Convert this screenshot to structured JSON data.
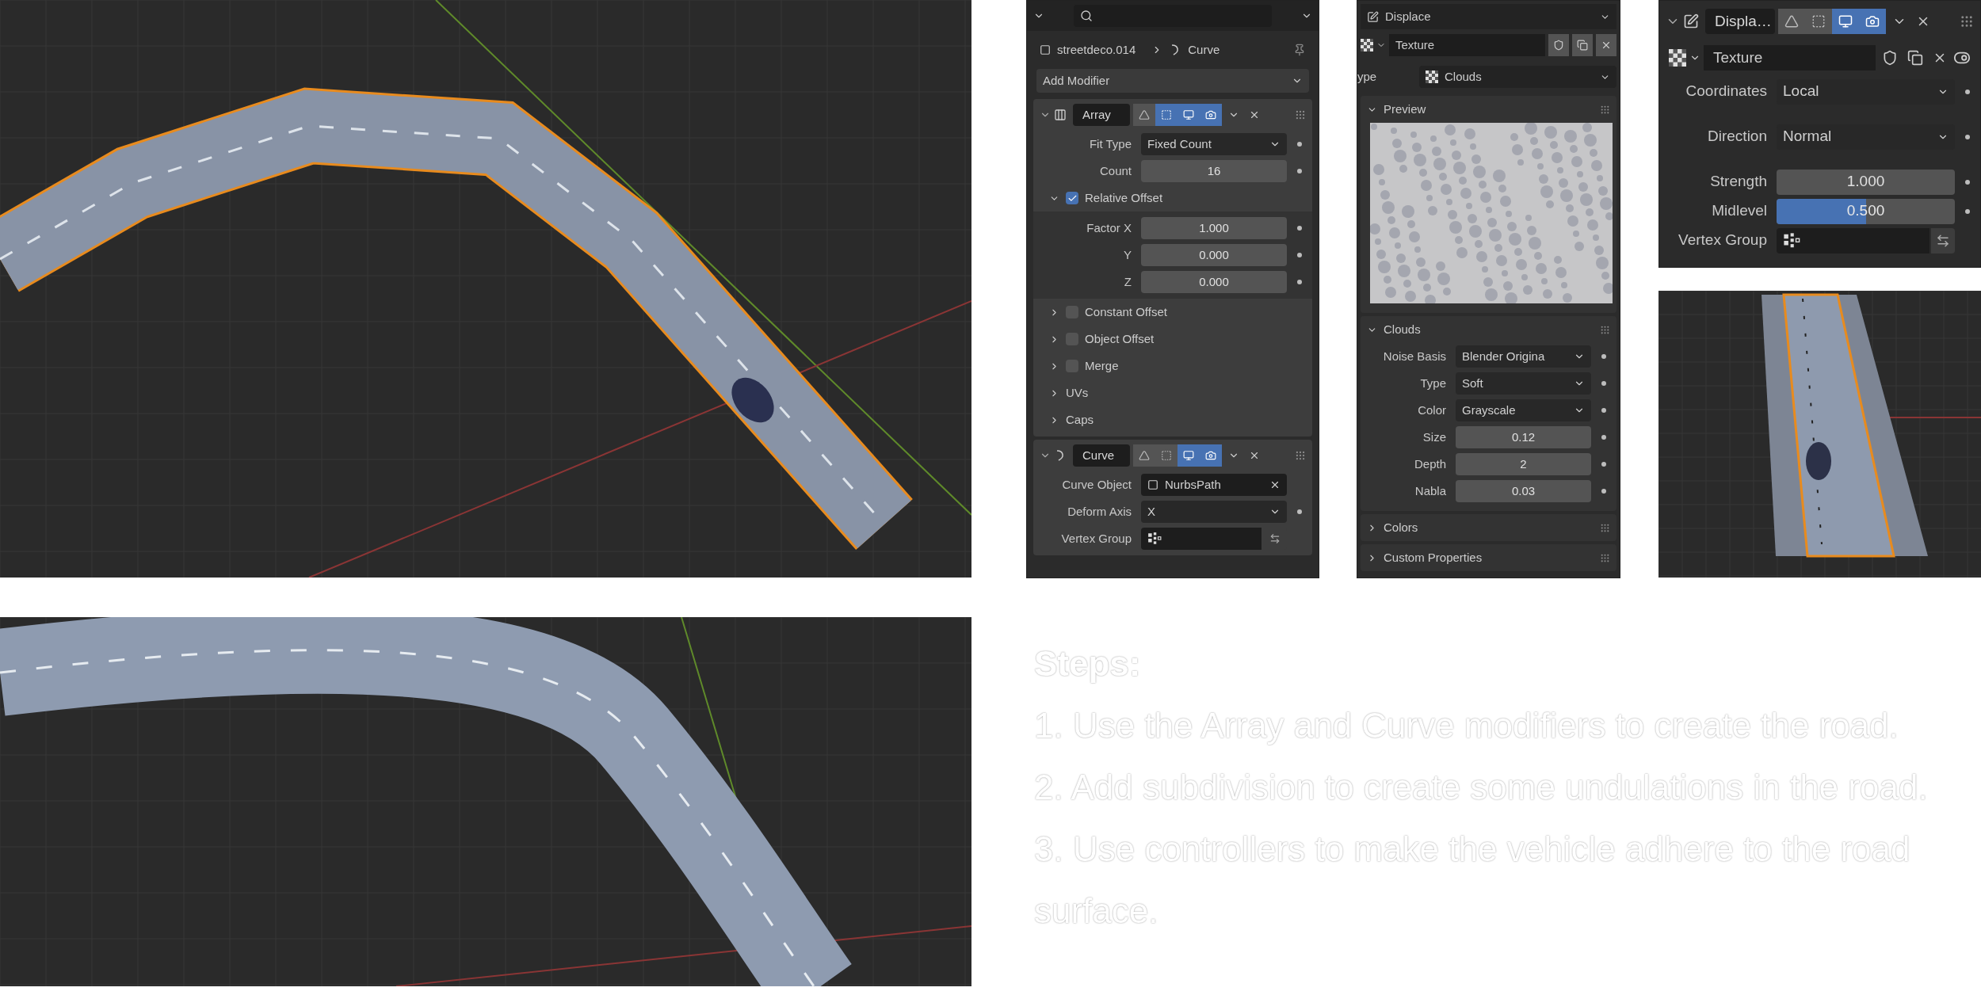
{
  "modifier_panel": {
    "breadcrumb": [
      {
        "kind": "object",
        "label": "streetdeco.014"
      },
      {
        "kind": "curve",
        "label": "Curve"
      }
    ],
    "add_modifier": "Add Modifier",
    "modifiers": [
      {
        "kind": "array",
        "name": "Array",
        "expanded": true,
        "toggles": [
          {
            "on": false
          },
          {
            "on": true
          },
          {
            "on": true
          },
          {
            "on": true
          }
        ],
        "rows": [
          {
            "kind": "dropdown",
            "label": "Fit Type",
            "value": "Fixed Count"
          },
          {
            "kind": "number",
            "label": "Count",
            "value": "16"
          }
        ],
        "subpanels": [
          {
            "kind": "checkbox",
            "label": "Relative Offset",
            "expanded": true,
            "checked": true,
            "rows": [
              {
                "kind": "number",
                "label": "Factor X",
                "value": "1.000"
              },
              {
                "kind": "number",
                "label": "Y",
                "value": "0.000"
              },
              {
                "kind": "number",
                "label": "Z",
                "value": "0.000"
              }
            ]
          },
          {
            "kind": "checkbox",
            "label": "Constant Offset",
            "expanded": false,
            "checked": false
          },
          {
            "kind": "checkbox",
            "label": "Object Offset",
            "expanded": false,
            "checked": false
          },
          {
            "kind": "checkbox",
            "label": "Merge",
            "expanded": false,
            "checked": false
          },
          {
            "kind": "plain",
            "label": "UVs",
            "expanded": false
          },
          {
            "kind": "plain",
            "label": "Caps",
            "expanded": false
          }
        ]
      },
      {
        "kind": "curve",
        "name": "Curve",
        "expanded": true,
        "toggles": [
          {
            "on": false
          },
          {
            "on": false
          },
          {
            "on": true
          },
          {
            "on": true
          }
        ],
        "rows": [
          {
            "kind": "object",
            "label": "Curve Object",
            "value": "NurbsPath"
          },
          {
            "kind": "dropdown",
            "label": "Deform Axis",
            "value": "X"
          },
          {
            "kind": "vertex_group",
            "label": "Vertex Group"
          }
        ]
      }
    ]
  },
  "texture_panel": {
    "modifier_select": "Displace",
    "texture_name": "Texture",
    "type_label": "ype",
    "type_value": "Clouds",
    "sections": [
      {
        "kind": "preview",
        "label": "Preview",
        "expanded": true
      },
      {
        "kind": "fields",
        "label": "Clouds",
        "expanded": true,
        "rows": [
          {
            "kind": "dropdown",
            "label": "Noise Basis",
            "value": "Blender Origina"
          },
          {
            "kind": "dropdown",
            "label": "Type",
            "value": "Soft"
          },
          {
            "kind": "dropdown",
            "label": "Color",
            "value": "Grayscale"
          },
          {
            "kind": "number",
            "label": "Size",
            "value": "0.12"
          },
          {
            "kind": "number",
            "label": "Depth",
            "value": "2"
          },
          {
            "kind": "number",
            "label": "Nabla",
            "value": "0.03"
          }
        ]
      },
      {
        "kind": "fields",
        "label": "Colors",
        "expanded": false
      },
      {
        "kind": "fields",
        "label": "Custom Properties",
        "expanded": false
      }
    ]
  },
  "displace_panel": {
    "name": "Displa…",
    "expanded": true,
    "toggles": [
      {
        "on": false
      },
      {
        "on": false
      },
      {
        "on": true
      },
      {
        "on": true
      }
    ],
    "texture_name": "Texture",
    "rows": [
      {
        "kind": "dropdown",
        "label": "Coordinates",
        "value": "Local"
      },
      {
        "kind": "dropdown",
        "label": "Direction",
        "value": "Normal"
      },
      {
        "kind": "number",
        "label": "Strength",
        "value": "1.000"
      },
      {
        "kind": "slider",
        "label": "Midlevel",
        "value": "0.500",
        "level": 0.5
      },
      {
        "kind": "vertex_group",
        "label": "Vertex Group"
      }
    ]
  },
  "steps": {
    "title": "Steps:",
    "items": [
      "1. Use the Array and Curve modifiers to create the road.",
      "2. Add subdivision to create some undulations in the road.",
      "3. Use controllers to make the vehicle adhere to the road surface."
    ]
  }
}
